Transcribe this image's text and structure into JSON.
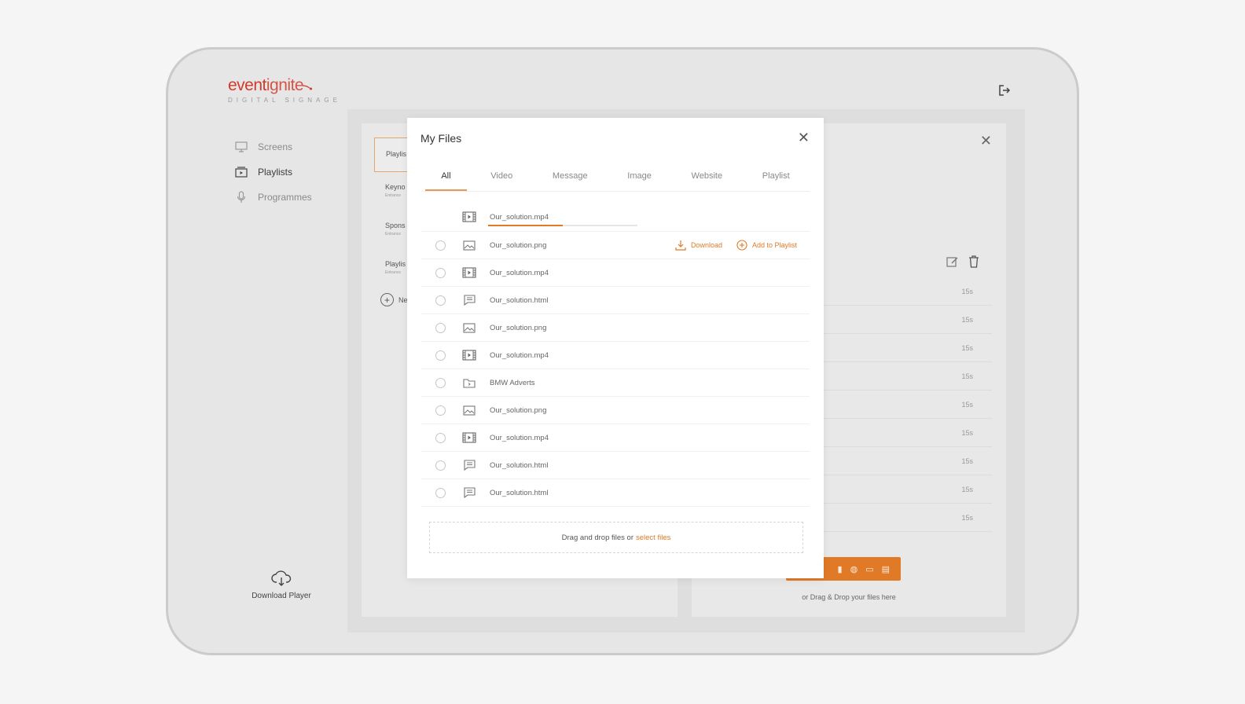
{
  "brand": {
    "name_bold": "event",
    "name_light": "ignite",
    "tagline": "DIGITAL SIGNAGE"
  },
  "sidebar": {
    "items": [
      {
        "label": "Screens",
        "icon": "monitor-icon",
        "active": false
      },
      {
        "label": "Playlists",
        "icon": "playlist-icon",
        "active": true
      },
      {
        "label": "Programmes",
        "icon": "microphone-icon",
        "active": false
      }
    ],
    "download_player": "Download Player"
  },
  "playlists_panel": {
    "items": [
      {
        "label": "Playlis",
        "sub": ""
      },
      {
        "label": "Keyno",
        "sub": "Entrance"
      },
      {
        "label": "Spons",
        "sub": "Entrance"
      },
      {
        "label": "Playlis",
        "sub": "Entrance"
      }
    ],
    "new_label": "Ne"
  },
  "right_panel": {
    "durations": [
      "15s",
      "15s",
      "15s",
      "15s",
      "15s",
      "15s",
      "15s",
      "15s",
      "15s"
    ],
    "drag_hint": "or Drag & Drop your files here"
  },
  "modal": {
    "title": "My Files",
    "tabs": [
      "All",
      "Video",
      "Message",
      "Image",
      "Website",
      "Playlist"
    ],
    "active_tab": "All",
    "uploading": {
      "name": "Our_solution.mp4",
      "type": "video",
      "progress": 0.5
    },
    "files": [
      {
        "name": "Our_solution.png",
        "type": "image"
      },
      {
        "name": "Our_solution.mp4",
        "type": "video"
      },
      {
        "name": "Our_solution.html",
        "type": "message"
      },
      {
        "name": "Our_solution.png",
        "type": "image"
      },
      {
        "name": "Our_solution.mp4",
        "type": "video"
      },
      {
        "name": "BMW Adverts",
        "type": "folder"
      },
      {
        "name": "Our_solution.png",
        "type": "image"
      },
      {
        "name": "Our_solution.mp4",
        "type": "video"
      },
      {
        "name": "Our_solution.html",
        "type": "message"
      },
      {
        "name": "Our_solution.html",
        "type": "message"
      }
    ],
    "row_actions": {
      "download": "Download",
      "add_to_playlist": "Add to Playlist"
    },
    "dropzone": {
      "text": "Drag and drop files or",
      "link": "select files"
    }
  },
  "colors": {
    "accent": "#e07a27",
    "brand_red": "#d23a2c"
  }
}
